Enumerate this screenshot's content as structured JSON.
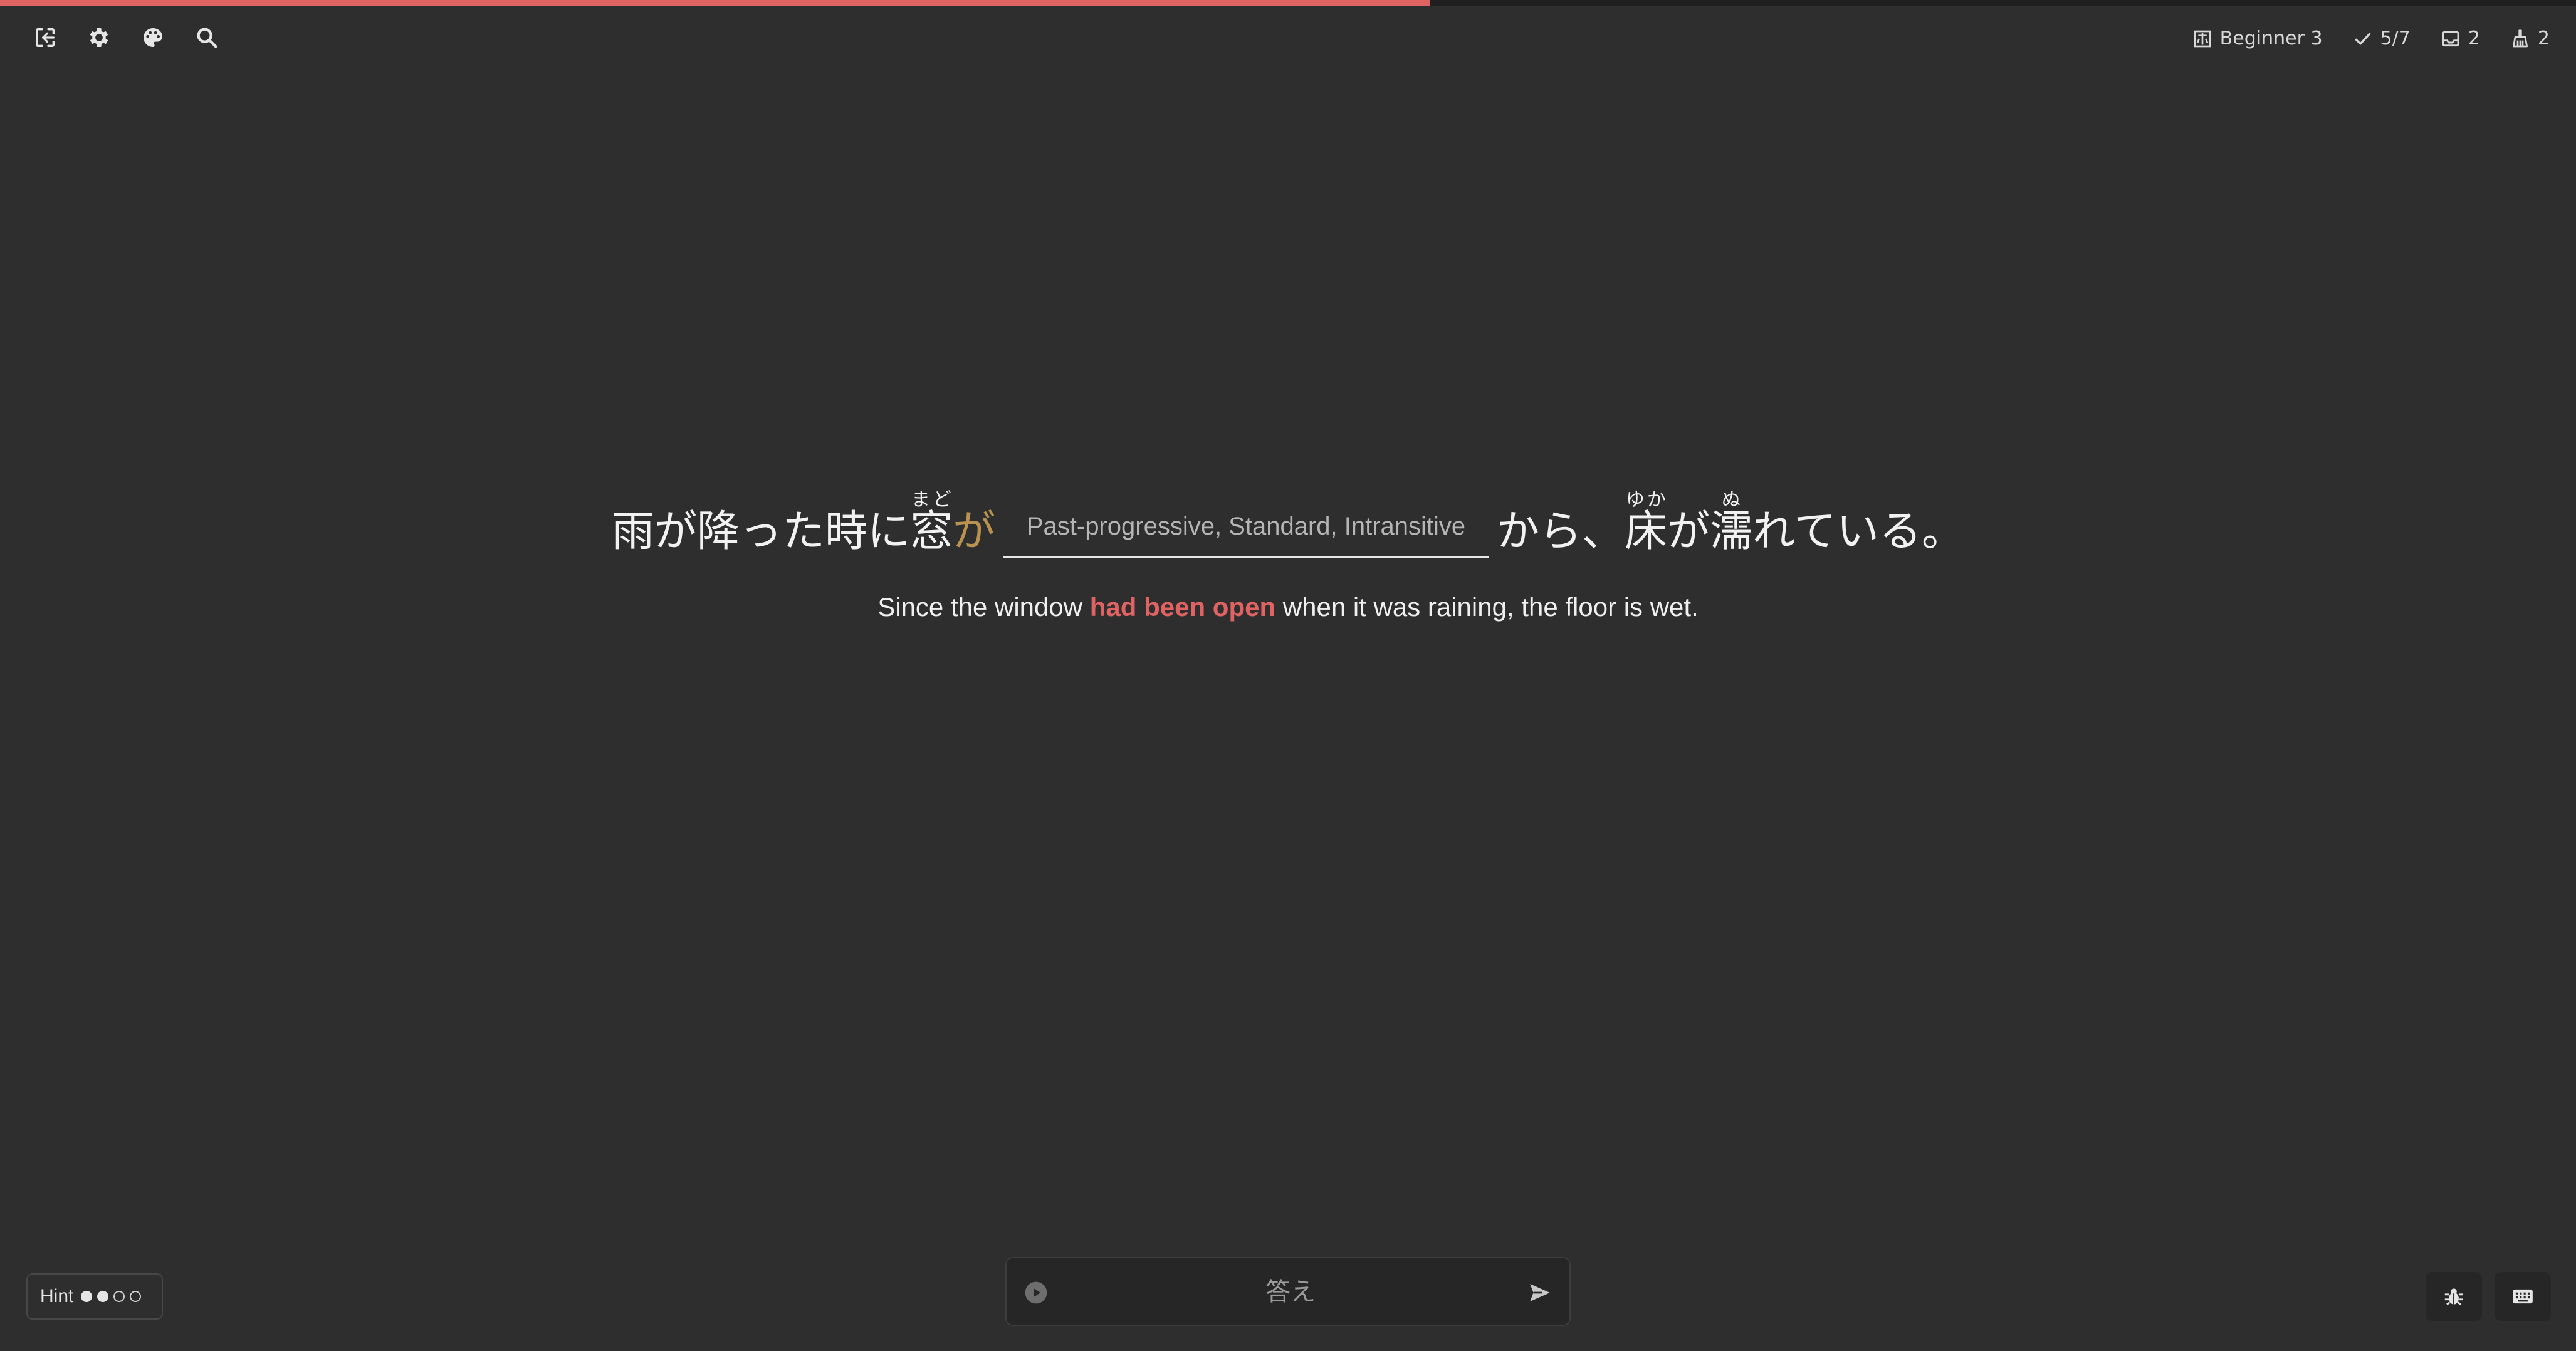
{
  "progress": {
    "fraction": 0.555
  },
  "toolbar": {
    "exit_icon": "exit-icon",
    "settings_icon": "gear-icon",
    "theme_icon": "palette-icon",
    "search_icon": "search-icon"
  },
  "stats": {
    "level": "Beginner 3",
    "correct": "5/7",
    "inbox": "2",
    "cleanup": "2"
  },
  "sentence": {
    "before": "雨が降った時に",
    "word1_base": "窓",
    "word1_reading": "まど",
    "particle": "が",
    "blank_hint": "Past-progressive, Standard, Intransitive",
    "after1": "から、",
    "word2_base": "床",
    "word2_reading": "ゆか",
    "middle": "が",
    "word3_base": "濡",
    "word3_reading": "ぬ",
    "after2": "れている。"
  },
  "translation": {
    "before": "Since the window ",
    "highlight": "had been open",
    "after": " when it was raining, the floor is wet."
  },
  "hint": {
    "label": "Hint",
    "filled": 2,
    "total": 4
  },
  "answer": {
    "placeholder": "答え",
    "value": ""
  },
  "colors": {
    "accent": "#e06363",
    "particle": "#b8924e",
    "background": "#2e2e2e"
  }
}
